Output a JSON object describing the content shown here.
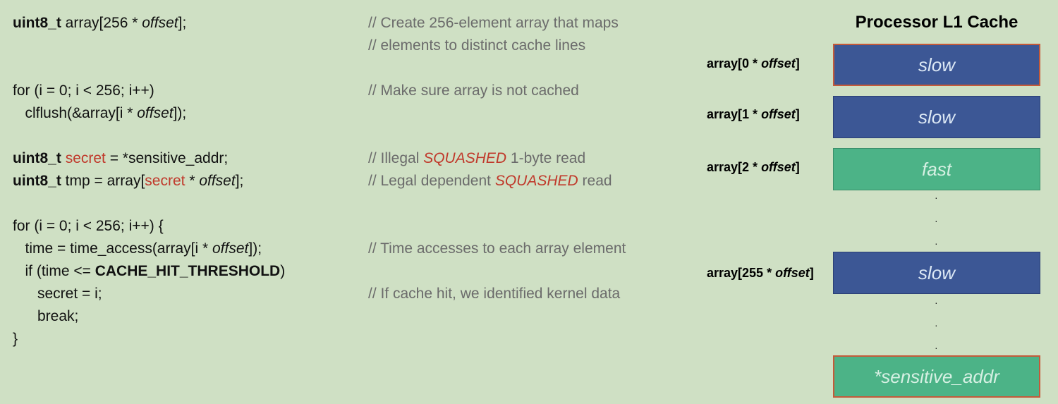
{
  "code": {
    "l1": {
      "type": "uint8_t",
      "a": " array[256 * ",
      "offset": "offset",
      "b": "];"
    },
    "l3": {
      "text": "for (i = 0; i < 256; i++)"
    },
    "l4": {
      "a": "   clflush(&array[i * ",
      "offset": "offset",
      "b": "]);"
    },
    "l5": {
      "type": "uint8_t",
      "sp": " ",
      "secret": "secret",
      "b": " = *sensitive_addr;"
    },
    "l6": {
      "type": "uint8_t",
      "a": " tmp = array[",
      "secret": "secret",
      "b": " * ",
      "offset": "offset",
      "c": "];"
    },
    "l7": {
      "text": "for (i = 0; i < 256; i++) {"
    },
    "l8": {
      "a": "   time = time_access(array[i * ",
      "offset": "offset",
      "b": "]);"
    },
    "l9": {
      "a": "   if (time <= ",
      "threshold": "CACHE_HIT_THRESHOLD",
      "b": ")"
    },
    "l10": {
      "text": "      secret = i;"
    },
    "l11": {
      "text": "      break;"
    },
    "l12": {
      "text": "}"
    }
  },
  "comments": {
    "c1": "// Create 256-element array that maps",
    "c2": "// elements to distinct cache lines",
    "c3": "// Make sure array is not cached",
    "c5a": "// Illegal ",
    "c5b": "SQUASHED",
    "c5c": " 1-byte read",
    "c6a": "// Legal dependent ",
    "c6b": "SQUASHED",
    "c6c": " read",
    "c8": "// Time accesses to each array element",
    "c10": "// If cache hit, we identified kernel data"
  },
  "cache": {
    "title": "Processor L1 Cache",
    "offset_word": "offset",
    "rows": [
      {
        "label_a": "array[0 * ",
        "label_b": "]",
        "state": "slow"
      },
      {
        "label_a": "array[1 * ",
        "label_b": "]",
        "state": "slow"
      },
      {
        "label_a": "array[2 * ",
        "label_b": "]",
        "state": "fast"
      },
      {
        "label_a": "array[255 * ",
        "label_b": "]",
        "state": "slow"
      }
    ],
    "sensitive": "*sensitive_addr",
    "colors": {
      "slow": "#3c5795",
      "fast": "#4cb387",
      "border_highlight": "#c45a3a"
    }
  }
}
